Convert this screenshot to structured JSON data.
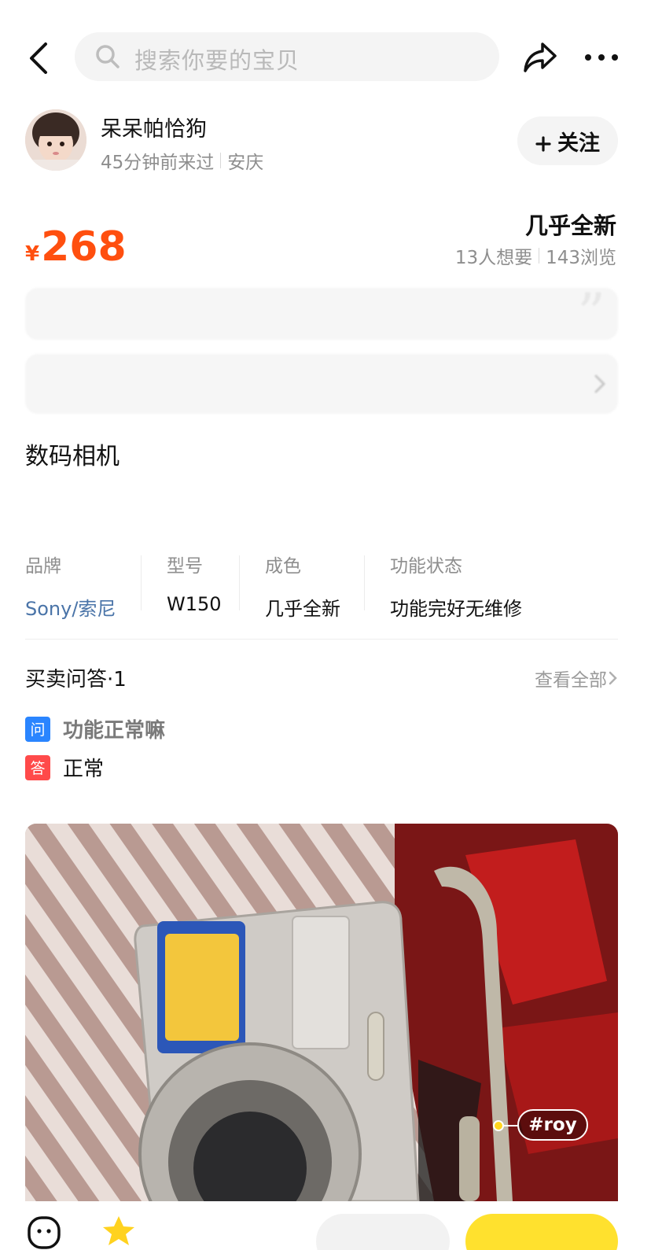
{
  "search": {
    "placeholder": "搜索你要的宝贝"
  },
  "seller": {
    "name": "呆呆帕恰狗",
    "last_seen": "45分钟前来过",
    "location": "安庆",
    "follow_label": "关注"
  },
  "price": {
    "currency": "¥",
    "amount": "268"
  },
  "condition_tag": "几乎全新",
  "stats": {
    "wants": "13人想要",
    "views": "143浏览"
  },
  "item_title": "数码相机",
  "attributes": [
    {
      "label": "品牌",
      "value": "Sony/索尼"
    },
    {
      "label": "型号",
      "value": "W150"
    },
    {
      "label": "成色",
      "value": "几乎全新"
    },
    {
      "label": "功能状态",
      "value": "功能完好无维修"
    }
  ],
  "qa": {
    "title": "买卖问答·1",
    "view_all": "查看全部",
    "question_badge": "问",
    "question": "功能正常嘛",
    "answer_badge": "答",
    "answer": "正常"
  },
  "photo": {
    "tag": "#roy"
  },
  "colors": {
    "price": "#ff4f0f",
    "highlight": "#ffe33a",
    "link": "#4a74a8",
    "cta": "#ffe12e"
  }
}
